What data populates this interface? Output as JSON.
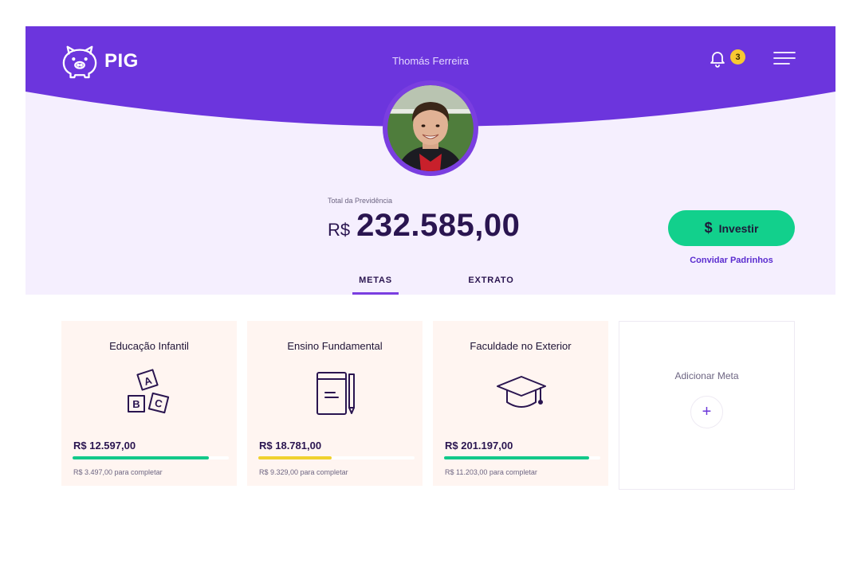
{
  "brand": {
    "name": "PIG",
    "logo_icon": "piggy-bank-icon"
  },
  "header": {
    "user_name": "Thomás Ferreira",
    "notifications_count": "3",
    "bell_icon": "bell-icon",
    "menu_icon": "hamburger-menu-icon"
  },
  "colors": {
    "primary": "#6c35dd",
    "accent_green": "#12d08c",
    "badge_yellow": "#f7c932",
    "surface": "#f5effe",
    "card_bg": "#fff5f1",
    "text_dark": "#2a1550"
  },
  "summary": {
    "total_label": "Total da Previdência",
    "currency": "R$",
    "amount": "232.585,00",
    "invest_icon": "dollar-sign-icon",
    "invest_label": "Investir",
    "invite_label": "Convidar Padrinhos"
  },
  "tabs": [
    {
      "label": "METAS",
      "active": true
    },
    {
      "label": "EXTRATO",
      "active": false
    }
  ],
  "goals": [
    {
      "title": "Educação Infantil",
      "icon": "abc-blocks-icon",
      "amount": "R$ 12.597,00",
      "progress": 0.87,
      "bar_color": "#12c98a",
      "remaining": "R$ 3.497,00 para completar"
    },
    {
      "title": "Ensino Fundamental",
      "icon": "notebook-pencil-icon",
      "amount": "R$ 18.781,00",
      "progress": 0.47,
      "bar_color": "#f0d12e",
      "remaining": "R$ 9.329,00 para completar"
    },
    {
      "title": "Faculdade no Exterior",
      "icon": "graduation-cap-icon",
      "amount": "R$ 201.197,00",
      "progress": 0.93,
      "bar_color": "#12c98a",
      "remaining": "R$ 11.203,00 para completar"
    }
  ],
  "add_goal": {
    "label": "Adicionar Meta",
    "button_symbol": "+"
  }
}
